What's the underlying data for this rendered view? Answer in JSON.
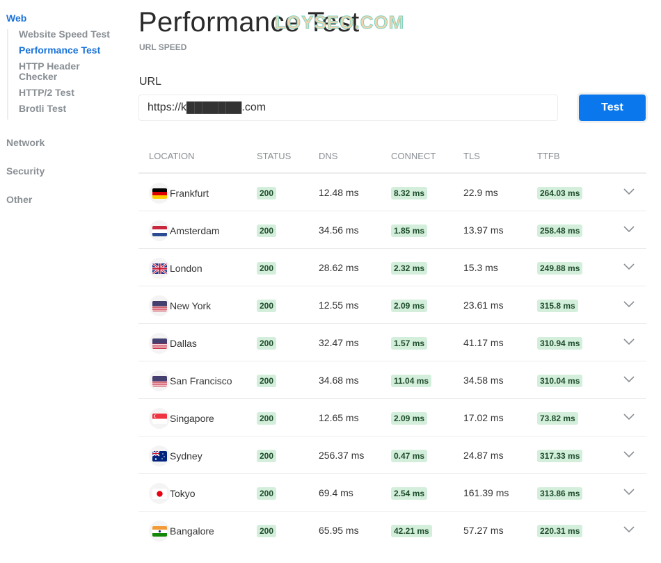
{
  "sidebar": {
    "sections": [
      {
        "label": "Web",
        "active": true
      },
      {
        "label": "Network",
        "active": false
      },
      {
        "label": "Security",
        "active": false
      },
      {
        "label": "Other",
        "active": false
      }
    ],
    "web_items": [
      {
        "label": "Website Speed Test",
        "active": false
      },
      {
        "label": "Performance Test",
        "active": true
      },
      {
        "label": "HTTP Header Checker",
        "active": false
      },
      {
        "label": "HTTP/2 Test",
        "active": false
      },
      {
        "label": "Brotli Test",
        "active": false
      }
    ]
  },
  "header": {
    "title": "Performance Test",
    "subtitle": "URL SPEED",
    "watermark": "LOYSEO.COM"
  },
  "form": {
    "url_label": "URL",
    "url_value": "https://k███████.com",
    "test_button": "Test"
  },
  "table": {
    "columns": [
      "LOCATION",
      "STATUS",
      "DNS",
      "CONNECT",
      "TLS",
      "TTFB"
    ],
    "rows": [
      {
        "flag": "de",
        "location": "Frankfurt",
        "status": "200",
        "dns": "12.48 ms",
        "connect": "8.32 ms",
        "tls": "22.9 ms",
        "ttfb": "264.03 ms"
      },
      {
        "flag": "nl",
        "location": "Amsterdam",
        "status": "200",
        "dns": "34.56 ms",
        "connect": "1.85 ms",
        "tls": "13.97 ms",
        "ttfb": "258.48 ms"
      },
      {
        "flag": "gb",
        "location": "London",
        "status": "200",
        "dns": "28.62 ms",
        "connect": "2.32 ms",
        "tls": "15.3 ms",
        "ttfb": "249.88 ms"
      },
      {
        "flag": "us",
        "location": "New York",
        "status": "200",
        "dns": "12.55 ms",
        "connect": "2.09 ms",
        "tls": "23.61 ms",
        "ttfb": "315.8 ms"
      },
      {
        "flag": "us",
        "location": "Dallas",
        "status": "200",
        "dns": "32.47 ms",
        "connect": "1.57 ms",
        "tls": "41.17 ms",
        "ttfb": "310.94 ms"
      },
      {
        "flag": "us",
        "location": "San Francisco",
        "status": "200",
        "dns": "34.68 ms",
        "connect": "11.04 ms",
        "tls": "34.58 ms",
        "ttfb": "310.04 ms"
      },
      {
        "flag": "sg",
        "location": "Singapore",
        "status": "200",
        "dns": "12.65 ms",
        "connect": "2.09 ms",
        "tls": "17.02 ms",
        "ttfb": "73.82 ms"
      },
      {
        "flag": "au",
        "location": "Sydney",
        "status": "200",
        "dns": "256.37 ms",
        "connect": "0.47 ms",
        "tls": "24.87 ms",
        "ttfb": "317.33 ms"
      },
      {
        "flag": "jp",
        "location": "Tokyo",
        "status": "200",
        "dns": "69.4 ms",
        "connect": "2.54 ms",
        "tls": "161.39 ms",
        "ttfb": "313.86 ms"
      },
      {
        "flag": "in",
        "location": "Bangalore",
        "status": "200",
        "dns": "65.95 ms",
        "connect": "42.21 ms",
        "tls": "57.27 ms",
        "ttfb": "220.31 ms"
      }
    ]
  },
  "colors": {
    "accent": "#1a73d9",
    "button": "#0a78ec",
    "badge_bg": "#d4eedc",
    "badge_text": "#1d4d2a"
  }
}
